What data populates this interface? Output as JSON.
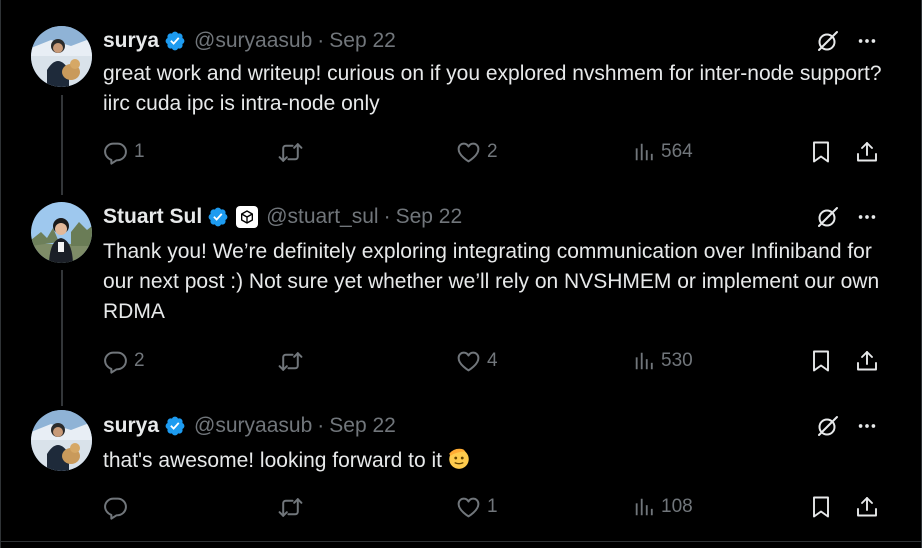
{
  "tweets": [
    {
      "name": "surya",
      "handle": "@suryaasub",
      "separator": "·",
      "date": "Sep 22",
      "text": "great work and writeup! curious on if you explored nvshmem for inter-node support? iirc cuda ipc is intra-node only",
      "replies": "1",
      "reposts": "",
      "likes": "2",
      "views": "564"
    },
    {
      "name": "Stuart Sul",
      "handle": "@stuart_sul",
      "separator": "·",
      "date": "Sep 22",
      "text": "Thank you! We’re definitely exploring integrating communication over Infiniband for our next post :) Not sure yet whether we’ll rely on NVSHMEM or implement our own RDMA",
      "replies": "2",
      "reposts": "",
      "likes": "4",
      "views": "530"
    },
    {
      "name": "surya",
      "handle": "@suryaasub",
      "separator": "·",
      "date": "Sep 22",
      "text": "that's awesome! looking forward to it",
      "emoji": "saluting-face-emoji",
      "replies": "",
      "reposts": "",
      "likes": "1",
      "views": "108"
    }
  ],
  "colors": {
    "background": "#000000",
    "text": "#e7e9ea",
    "muted": "#71767b",
    "verified": "#1d9bf0",
    "divider": "#2f3336"
  },
  "icons": [
    "verified-badge-icon",
    "grok-icon",
    "more-icon",
    "reply-icon",
    "repost-icon",
    "like-icon",
    "views-icon",
    "bookmark-icon",
    "share-icon",
    "affiliation-badge-icon"
  ]
}
